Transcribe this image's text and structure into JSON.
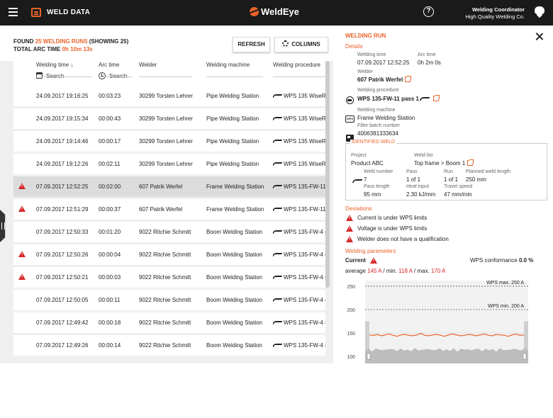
{
  "header": {
    "app_title": "WELD DATA",
    "brand": "WeldEye",
    "help": "?",
    "user_role": "Welding Coordinator",
    "user_company": "High Quality Welding Co."
  },
  "summary": {
    "found_prefix": "FOUND",
    "found_count": "25 WELDING RUNS",
    "found_suffix": "(SHOWING 25)",
    "arc_label": "TOTAL ARC TIME",
    "arc_value": "0h 10m 13s"
  },
  "toolbar": {
    "refresh_label": "REFRESH",
    "columns_label": "COLUMNS"
  },
  "table": {
    "columns": [
      "Welding time",
      "Arc time",
      "Welder",
      "Welding machine",
      "Welding procedure"
    ],
    "sort_indicator": "↓",
    "search_placeholder": "Search",
    "rows": [
      {
        "warning": false,
        "time": "24.09.2017 19:16:25",
        "arc": "00:03:23",
        "welder": "30299 Torsten Lehrer",
        "machine": "Pipe Welding Station",
        "wps": "WPS 135 WiseR"
      },
      {
        "warning": false,
        "time": "24.09.2017 19:15:34",
        "arc": "00:00:43",
        "welder": "30299 Torsten Lehrer",
        "machine": "Pipe Welding Station",
        "wps": "WPS 135 WiseR"
      },
      {
        "warning": false,
        "time": "24.09.2017 19:14:46",
        "arc": "00:00:17",
        "welder": "30299 Torsten Lehrer",
        "machine": "Pipe Welding Station",
        "wps": "WPS 135 WiseR"
      },
      {
        "warning": false,
        "time": "24.09.2017 19:12:26",
        "arc": "00:02:11",
        "welder": "30299 Torsten Lehrer",
        "machine": "Pipe Welding Station",
        "wps": "WPS 135 WiseR"
      },
      {
        "warning": true,
        "time": "07.09.2017 12:52:25",
        "arc": "00:02:00",
        "welder": "607 Patrik Werfel",
        "machine": "Frame Welding Station",
        "wps": "WPS 135-FW-11"
      },
      {
        "warning": true,
        "time": "07.09.2017 12:51:29",
        "arc": "00:00:37",
        "welder": "607 Patrik Werfel",
        "machine": "Frame Welding Station",
        "wps": "WPS 135-FW-11"
      },
      {
        "warning": false,
        "time": "07.09.2017 12:50:33",
        "arc": "00:01:20",
        "welder": "9022 Ritchie Schmitt",
        "machine": "Boom Welding Station",
        "wps": "WPS 135-FW-4 ("
      },
      {
        "warning": true,
        "time": "07.09.2017 12:50:26",
        "arc": "00:00:04",
        "welder": "9022 Ritchie Schmitt",
        "machine": "Boom Welding Station",
        "wps": "WPS 135-FW-4 ("
      },
      {
        "warning": true,
        "time": "07.09.2017 12:50:21",
        "arc": "00:00:03",
        "welder": "9022 Ritchie Schmitt",
        "machine": "Boom Welding Station",
        "wps": "WPS 135-FW-4 ("
      },
      {
        "warning": false,
        "time": "07.09.2017 12:50:05",
        "arc": "00:00:11",
        "welder": "9022 Ritchie Schmitt",
        "machine": "Boom Welding Station",
        "wps": "WPS 135-FW-4 ("
      },
      {
        "warning": false,
        "time": "07.09.2017 12:49:42",
        "arc": "00:00:18",
        "welder": "9022 Ritchie Schmitt",
        "machine": "Boom Welding Station",
        "wps": "WPS 135-FW-4 ("
      },
      {
        "warning": false,
        "time": "07.09.2017 12:49:26",
        "arc": "00:00:14",
        "welder": "9022 Ritchie Schmitt",
        "machine": "Boom Welding Station",
        "wps": "WPS 135-FW-4 ("
      }
    ],
    "selected_row": 4
  },
  "detail": {
    "title": "WELDING RUN",
    "details_heading": "Details",
    "welding_time_label": "Welding time",
    "welding_time": "07.09.2017 12:52:25",
    "arc_time_label": "Arc time",
    "arc_time": "0h 2m 0s",
    "welder_label": "Welder",
    "welder": "607 Patrik Werfel",
    "procedure_label": "Welding procedure",
    "procedure": "WPS 135-FW-11 pass 1",
    "machine_label": "Welding machine",
    "machine": "Frame Welding Station",
    "filler_label": "Filler batch number",
    "filler": "4006381333634",
    "identified": {
      "title": "IDENTIFIED WELD",
      "project_label": "Project",
      "project": "Product ABC",
      "weldlist_label": "Weld list",
      "weldlist": "Top frame > Boom 1",
      "weld_number_label": "Weld number",
      "weld_number": "7",
      "pass_label": "Pass",
      "pass": "1 of 1",
      "run_label": "Run",
      "run": "1 of 1",
      "planned_label": "Planned weld length",
      "planned": "250 mm",
      "pass_length_label": "Pass length",
      "pass_length": "95 mm",
      "heat_label": "Heat input",
      "heat": "2.30 kJ/mm",
      "speed_label": "Travel speed",
      "speed": "47 mm/min"
    },
    "deviations_heading": "Deviations",
    "deviations": [
      "Current is under WPS limits",
      "Voltage is under WPS limits",
      "Welder does not have a qualification"
    ],
    "params_heading": "Welding parameters",
    "current_label": "Current",
    "conformance_label": "WPS conformance",
    "conformance": "0.0 %",
    "avg_label": "average",
    "avg": "145 A",
    "min_label": "/ min.",
    "min": "118 A",
    "max_label": "/ max.",
    "max": "170 A"
  },
  "chart_data": {
    "type": "line",
    "series": [
      {
        "values": [
          146,
          145,
          147,
          144,
          146,
          148,
          145,
          143,
          146,
          147,
          145,
          144,
          146,
          149,
          145,
          144,
          146,
          147,
          145,
          143,
          146,
          148,
          146,
          144,
          145,
          147,
          146,
          144,
          146,
          148,
          145,
          144,
          147,
          146,
          145,
          143,
          146,
          148,
          145,
          146
        ]
      }
    ],
    "yticks": [
      250,
      200,
      150,
      100
    ],
    "ylim": [
      85,
      262
    ],
    "annotations": [
      "WPS max. 250 A",
      "WPS min. 200 A"
    ],
    "colors": {
      "line": "#e8632a",
      "band": "#cfcfcf"
    }
  }
}
